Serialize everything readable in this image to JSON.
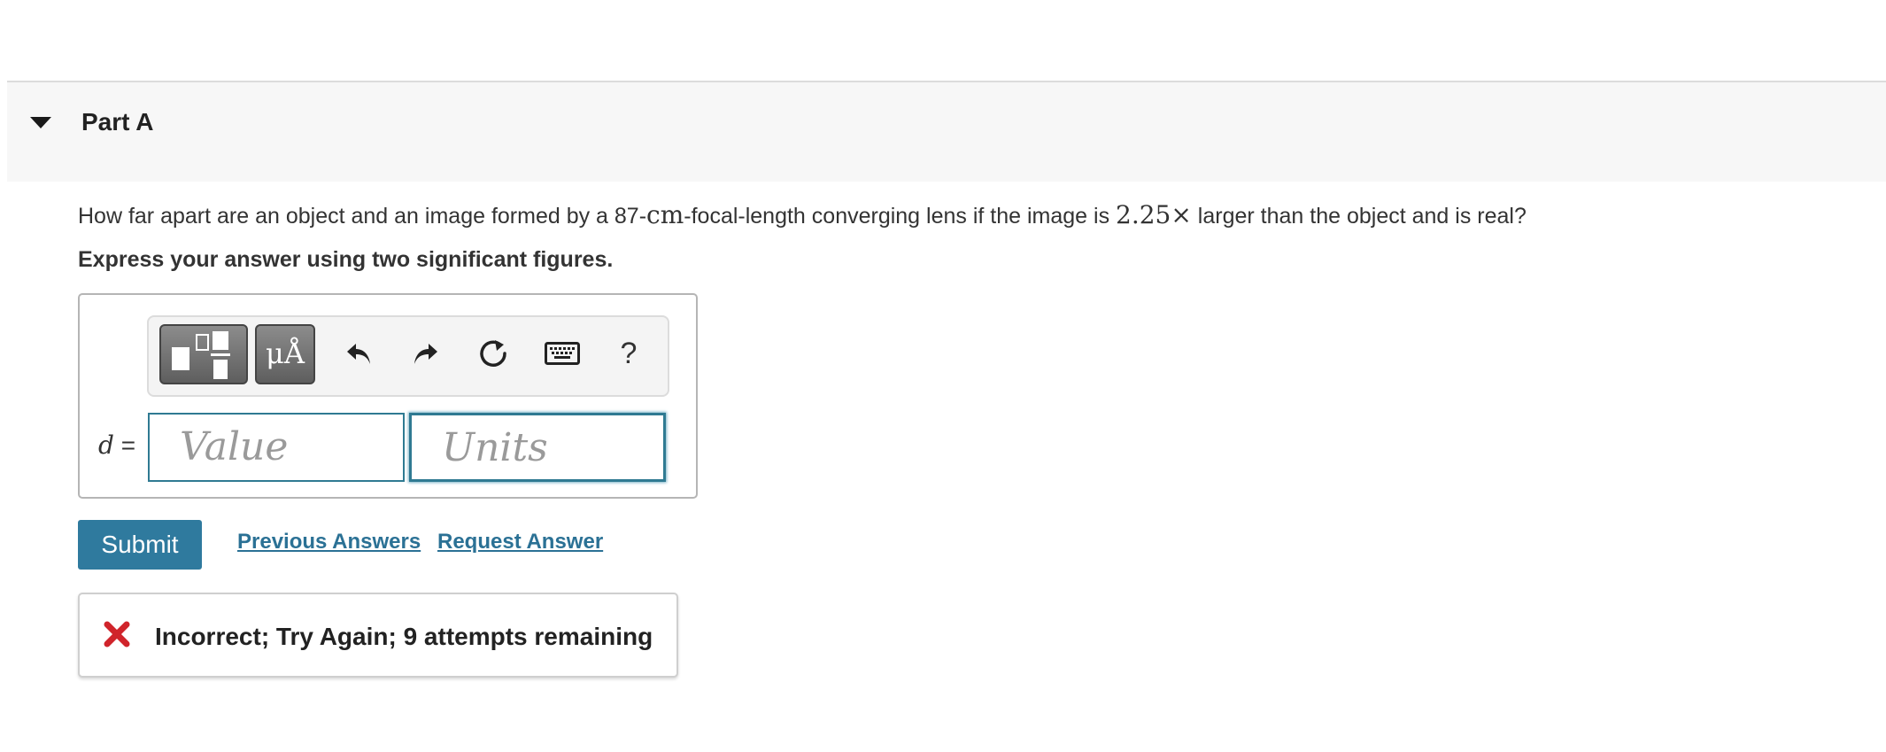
{
  "part": {
    "title": "Part A"
  },
  "question": {
    "text_1": "How far apart are an object and an image formed by a 87-",
    "unit_cm": "cm",
    "text_2": "-focal-length converging lens if the image is ",
    "magnification": "2.25×",
    "text_3": " larger than the object and is real?",
    "instruction": "Express your answer using two significant figures."
  },
  "toolbar": {
    "icons": [
      "fraction-template-icon",
      "units-template-icon",
      "undo-icon",
      "redo-icon",
      "reset-icon",
      "keyboard-icon",
      "help-icon"
    ],
    "units_glyph": "μÅ",
    "help_glyph": "?"
  },
  "answer": {
    "variable": "d",
    "equals": "=",
    "value_placeholder": "Value",
    "units_placeholder": "Units"
  },
  "actions": {
    "submit_label": "Submit",
    "previous_answers_label": "Previous Answers",
    "request_answer_label": "Request Answer"
  },
  "feedback": {
    "message": "Incorrect; Try Again; 9 attempts remaining",
    "status": "incorrect"
  },
  "colors": {
    "accent": "#2f7a9e",
    "link": "#2b7195",
    "error": "#d0242b",
    "header_bg": "#f7f7f7"
  }
}
